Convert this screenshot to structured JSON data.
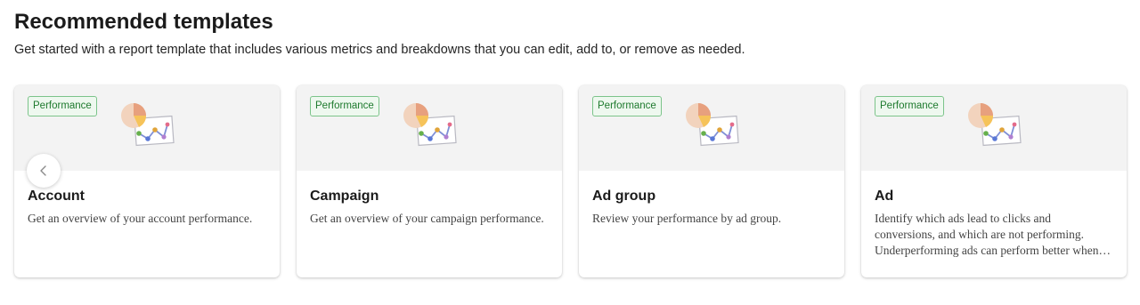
{
  "section": {
    "title": "Recommended templates",
    "subtitle": "Get started with a report template that includes various metrics and breakdowns that you can edit, add to, or remove as needed."
  },
  "carousel": {
    "prev_icon": "chevron-left-icon"
  },
  "cards": [
    {
      "tag": "Performance",
      "title": "Account",
      "description": "Get an overview of your account performance.",
      "icon": "report-chart-illustration"
    },
    {
      "tag": "Performance",
      "title": "Campaign",
      "description": "Get an overview of your campaign performance.",
      "icon": "report-chart-illustration"
    },
    {
      "tag": "Performance",
      "title": "Ad group",
      "description": "Review your performance by ad group.",
      "icon": "report-chart-illustration"
    },
    {
      "tag": "Performance",
      "title": "Ad",
      "description": "Identify which ads lead to clicks and conversions, and which are not performing. Underperforming ads can perform better when you adjust them.",
      "icon": "report-chart-illustration"
    }
  ],
  "colors": {
    "tag_border": "#7cc48a",
    "tag_bg": "#eef8ef",
    "tag_text": "#1e7a2e",
    "hero_bg": "#f3f3f3"
  }
}
